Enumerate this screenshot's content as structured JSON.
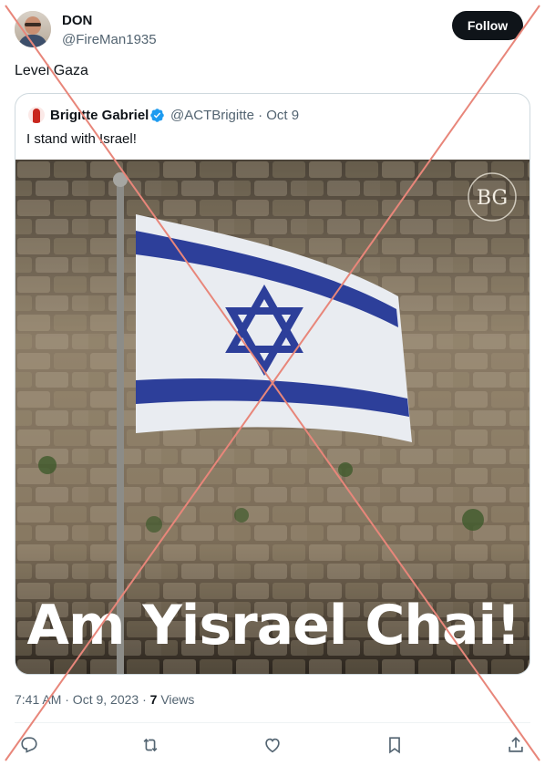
{
  "author": {
    "name": "DON",
    "handle": "@FireMan1935",
    "avatar_icon": "user-avatar"
  },
  "follow_label": "Follow",
  "tweet_text": "Level Gaza",
  "quoted": {
    "name": "Brigitte Gabriel",
    "verified": true,
    "handle_date": "@ACTBrigitte · Oct 9",
    "text": "I stand with Israel!",
    "image": {
      "caption": "Am Yisrael Chai!",
      "logo_text": "BG",
      "description_icon": "israel-flag-western-wall"
    }
  },
  "meta": {
    "timestamp": "7:41 AM · Oct 9, 2023 · ",
    "views_count": "7",
    "views_label": " Views"
  },
  "actions": [
    {
      "name": "reply",
      "icon": "reply-icon"
    },
    {
      "name": "retweet",
      "icon": "retweet-icon"
    },
    {
      "name": "like",
      "icon": "heart-icon"
    },
    {
      "name": "bookmark",
      "icon": "bookmark-icon"
    },
    {
      "name": "share",
      "icon": "share-icon"
    }
  ],
  "colors": {
    "follow_bg": "#0f1419",
    "secondary_text": "#536471",
    "verified_blue": "#1d9bf0",
    "cross_red": "#e8867a",
    "flag_blue": "#1e3aa0"
  }
}
